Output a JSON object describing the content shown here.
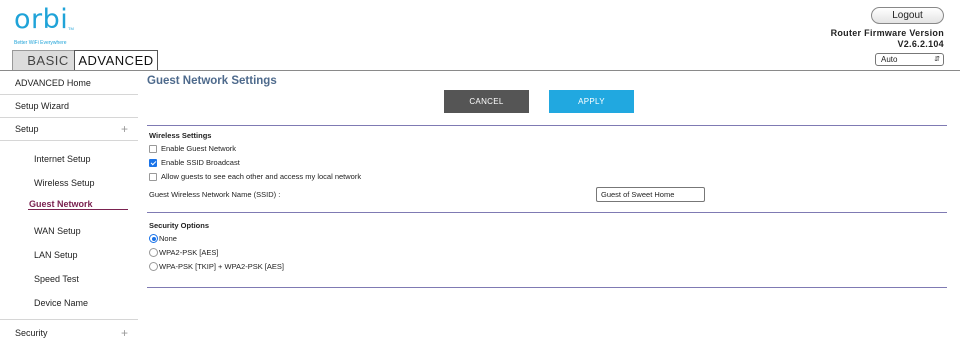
{
  "logo": {
    "word": "orbi",
    "trademark": "TM",
    "tagline": "Better WiFi Everywhere"
  },
  "tabs": [
    {
      "label": "BASIC"
    },
    {
      "label": "ADVANCED"
    }
  ],
  "header": {
    "logout_label": "Logout",
    "firmware_label": "Router Firmware Version",
    "firmware_version": "V2.6.2.104",
    "language_selected": "Auto"
  },
  "sidebar": {
    "items": [
      {
        "label": "ADVANCED Home"
      },
      {
        "label": "Setup Wizard"
      },
      {
        "label": "Setup",
        "expander": "+"
      },
      {
        "label": "Internet Setup"
      },
      {
        "label": "Wireless Setup"
      },
      {
        "label": "Guest Network"
      },
      {
        "label": "WAN Setup"
      },
      {
        "label": "LAN Setup"
      },
      {
        "label": "Speed Test"
      },
      {
        "label": "Device Name"
      },
      {
        "label": "Security",
        "expander": "+"
      }
    ]
  },
  "main": {
    "title": "Guest Network Settings",
    "cancel_label": "CANCEL",
    "apply_label": "APPLY",
    "wireless": {
      "heading": "Wireless Settings",
      "options": [
        {
          "label": "Enable Guest Network",
          "checked": false
        },
        {
          "label": "Enable SSID Broadcast",
          "checked": true
        },
        {
          "label": "Allow guests to see each other and access my local network",
          "checked": false
        }
      ],
      "ssid_label": "Guest Wireless Network Name (SSID) :",
      "ssid_value": "Guest of Sweet Home"
    },
    "security": {
      "heading": "Security Options",
      "options": [
        {
          "label": "None",
          "selected": true
        },
        {
          "label": "WPA2-PSK [AES]",
          "selected": false
        },
        {
          "label": "WPA-PSK [TKIP] + WPA2-PSK [AES]",
          "selected": false
        }
      ]
    }
  },
  "colors": {
    "brand": "#1fa3d8",
    "apply": "#21a8e0",
    "cancel": "#555555",
    "title": "#4e6a8c",
    "active_nav": "#7a2250",
    "divider": "#7f7ab3"
  }
}
